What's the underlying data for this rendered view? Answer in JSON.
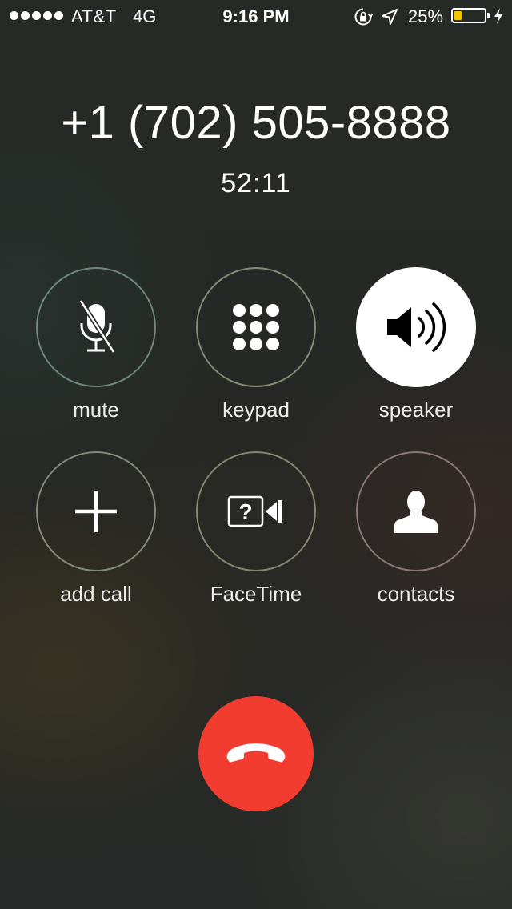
{
  "status_bar": {
    "carrier": "AT&T",
    "network": "4G",
    "time": "9:16 PM",
    "battery_percent": "25%",
    "battery_level": 0.25,
    "signal_dots": 5,
    "icons": [
      "signal-dots-icon",
      "orientation-lock-icon",
      "location-arrow-icon",
      "battery-icon",
      "charging-bolt-icon"
    ]
  },
  "call": {
    "number": "+1 (702) 505-8888",
    "duration": "52:11"
  },
  "controls": {
    "mute": {
      "label": "mute",
      "icon": "microphone-muted-icon"
    },
    "keypad": {
      "label": "keypad",
      "icon": "keypad-grid-icon"
    },
    "speaker": {
      "label": "speaker",
      "icon": "speaker-icon",
      "active": true
    },
    "add_call": {
      "label": "add call",
      "icon": "plus-icon"
    },
    "facetime": {
      "label": "FaceTime",
      "icon": "facetime-video-icon"
    },
    "contacts": {
      "label": "contacts",
      "icon": "person-silhouette-icon"
    }
  },
  "end_call": {
    "icon": "phone-hangup-icon",
    "color": "#f23c30"
  },
  "colors": {
    "battery_fill": "#f5c400",
    "end_call": "#f23c30",
    "text": "#ffffff"
  }
}
